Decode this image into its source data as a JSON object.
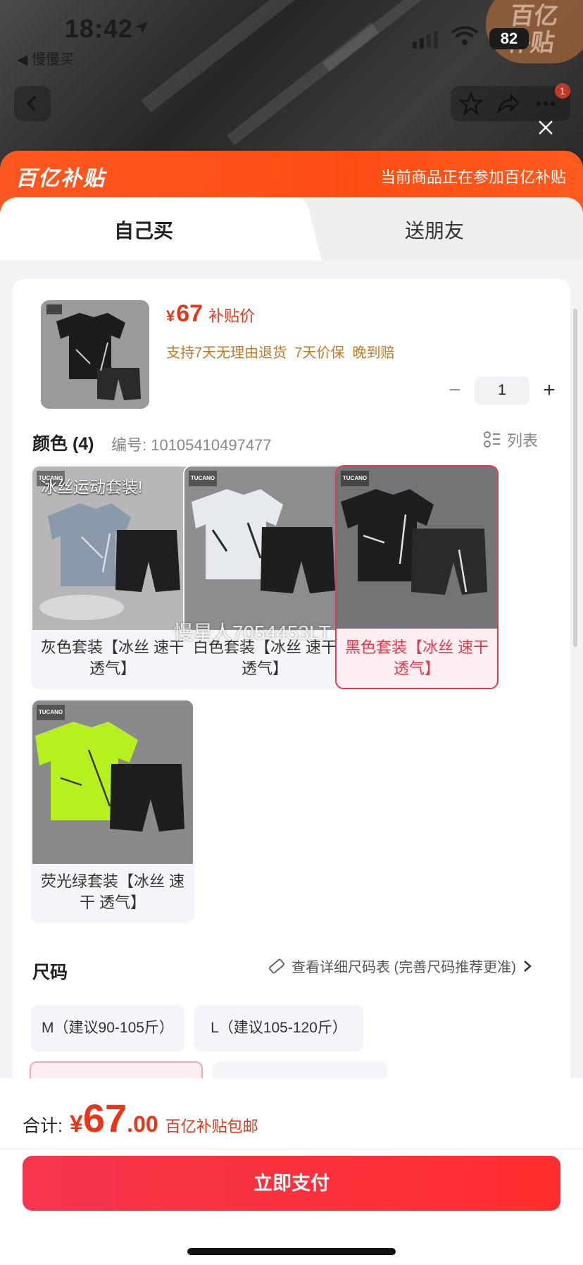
{
  "status_bar": {
    "time": "18:42",
    "back_app": "◀ 慢慢买",
    "battery": "82"
  },
  "background_page": {
    "badge_text": "百亿\n补贴",
    "cart_count": "1"
  },
  "banner": {
    "logo": "百亿补贴",
    "notice": "当前商品正在参加百亿补贴"
  },
  "tabs": [
    {
      "label": "自己买",
      "active": true
    },
    {
      "label": "送朋友",
      "active": false
    }
  ],
  "product": {
    "price_symbol": "¥",
    "price": "67",
    "price_label": "补贴价",
    "guarantees": "支持7天无理由退货  7天价保  晚到赔",
    "quantity": "1",
    "minus": "−",
    "plus": "+"
  },
  "color_section": {
    "title": "颜色 (4)",
    "code": "编号: 10105410497477",
    "list_toggle": "列表",
    "image_caption": "冰丝运动套装!",
    "brand_mark": "TUCANO",
    "watermark": "慢星人7054453LT",
    "options": [
      {
        "label": "灰色套装【冰丝 速干 透气】",
        "shirt_color": "#8a9aaa",
        "selected": false
      },
      {
        "label": "白色套装【冰丝 速干 透气】",
        "shirt_color": "#e6e9ee",
        "selected": false
      },
      {
        "label": "黑色套装【冰丝 速干 透气】",
        "shirt_color": "#1e1e1e",
        "selected": true
      },
      {
        "label": "荧光绿套装【冰丝 速干 透气】",
        "shirt_color": "#b6f01e",
        "selected": false
      }
    ]
  },
  "size_section": {
    "title": "尺码",
    "guide": "查看详细尺码表 (完善尺码推荐更准)",
    "options": [
      {
        "label": "M（建议90-105斤）"
      },
      {
        "label": "L（建议105-120斤）"
      }
    ]
  },
  "footer": {
    "total_label": "合计:",
    "currency": "¥",
    "amount_int": "67",
    "amount_dec": ".00",
    "note": "百亿补贴包邮",
    "pay_button": "立即支付"
  },
  "colors": {
    "accent_red": "#e8361b",
    "banner_orange": "#ff5722",
    "pay_red": "#f5364d"
  }
}
